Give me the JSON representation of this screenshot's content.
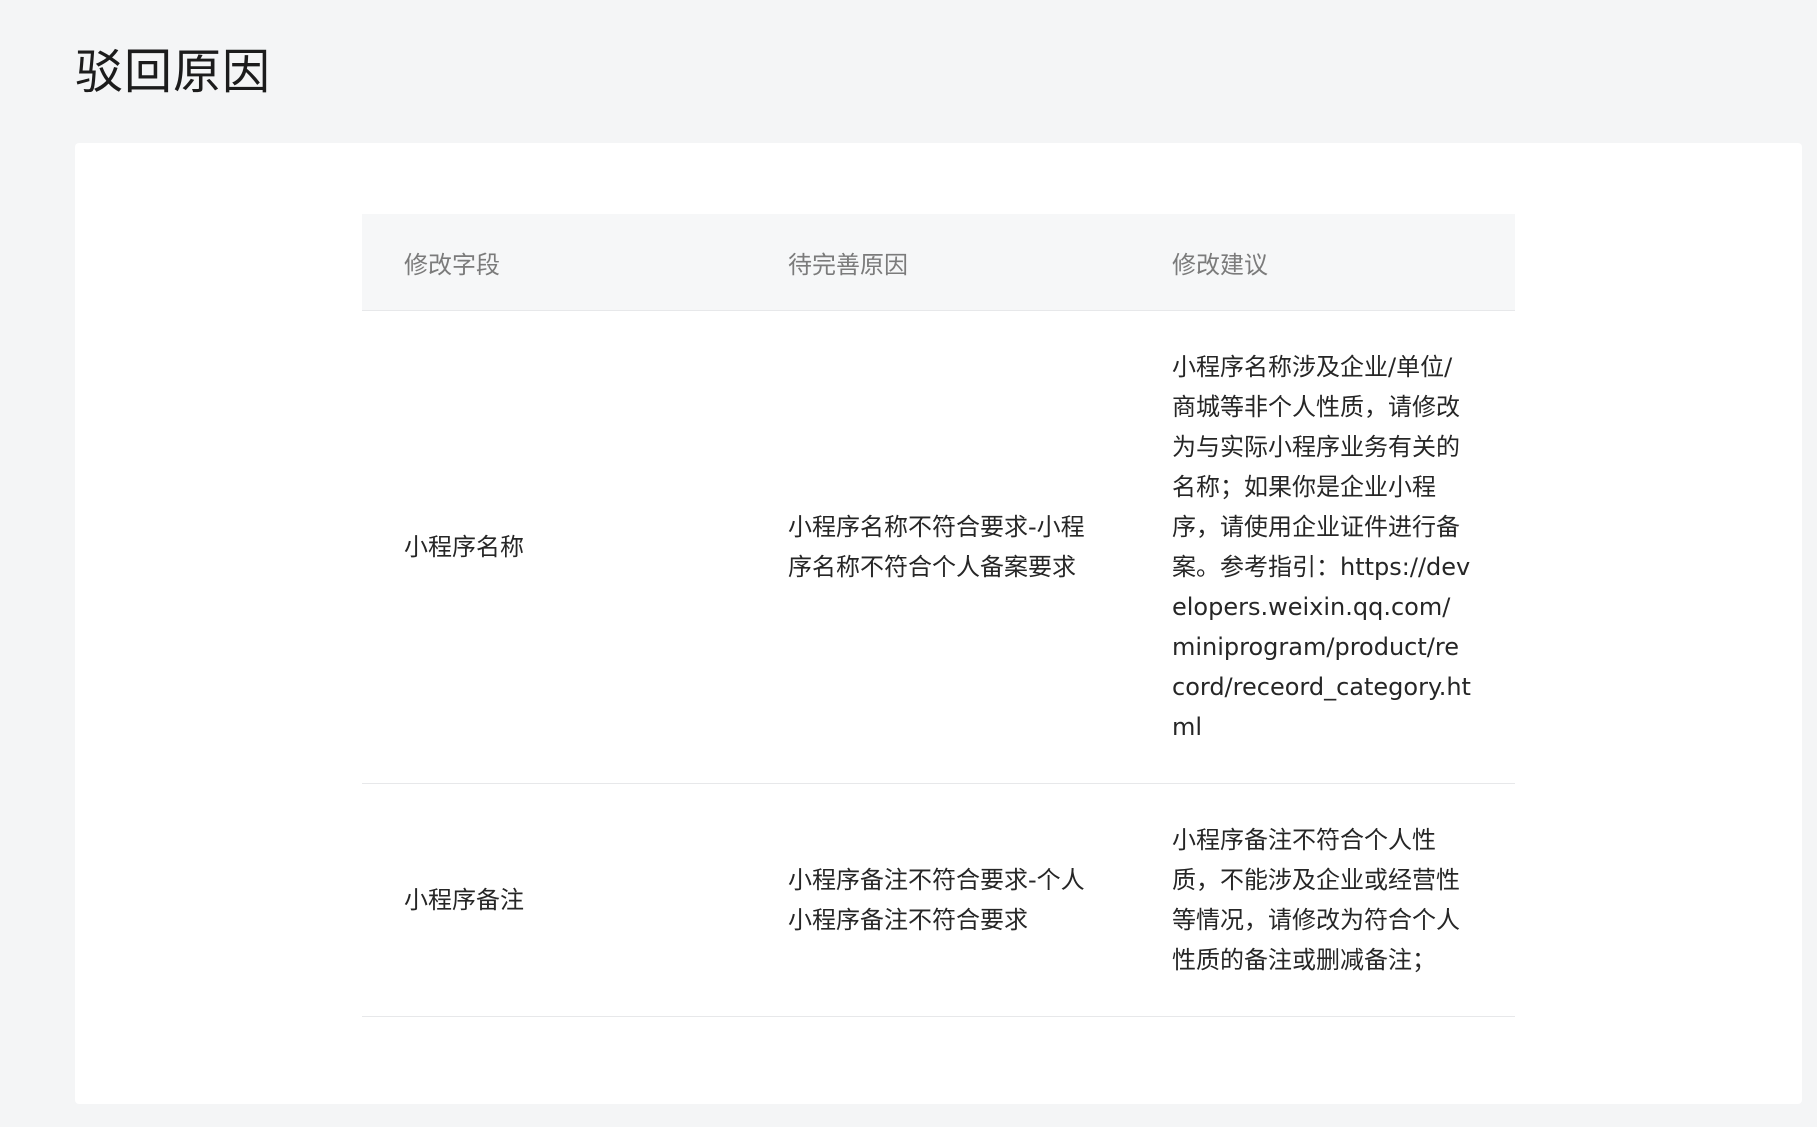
{
  "page": {
    "title": "驳回原因"
  },
  "table": {
    "columns": [
      "修改字段",
      "待完善原因",
      "修改建议"
    ],
    "rows": [
      {
        "field": "小程序名称",
        "reason": "小程序名称不符合要求-小程序名称不符合个人备案要求",
        "suggestion": "小程序名称涉及企业/单位/商城等非个人性质，请修改为与实际小程序业务有关的名称；如果你是企业小程序，请使用企业证件进行备案。参考指引：https://developers.weixin.qq.com/miniprogram/product/record/receord_category.html"
      },
      {
        "field": "小程序备注",
        "reason": "小程序备注不符合要求-个人小程序备注不符合要求",
        "suggestion": "小程序备注不符合个人性质，不能涉及企业或经营性等情况，请修改为符合个人性质的备注或删减备注；"
      }
    ]
  },
  "colors": {
    "page_background": "#f4f5f6",
    "card_background": "#ffffff",
    "header_background": "#f6f7f8",
    "header_text": "#7b7b7b",
    "body_text": "#262626",
    "divider": "#e7e8ea"
  }
}
